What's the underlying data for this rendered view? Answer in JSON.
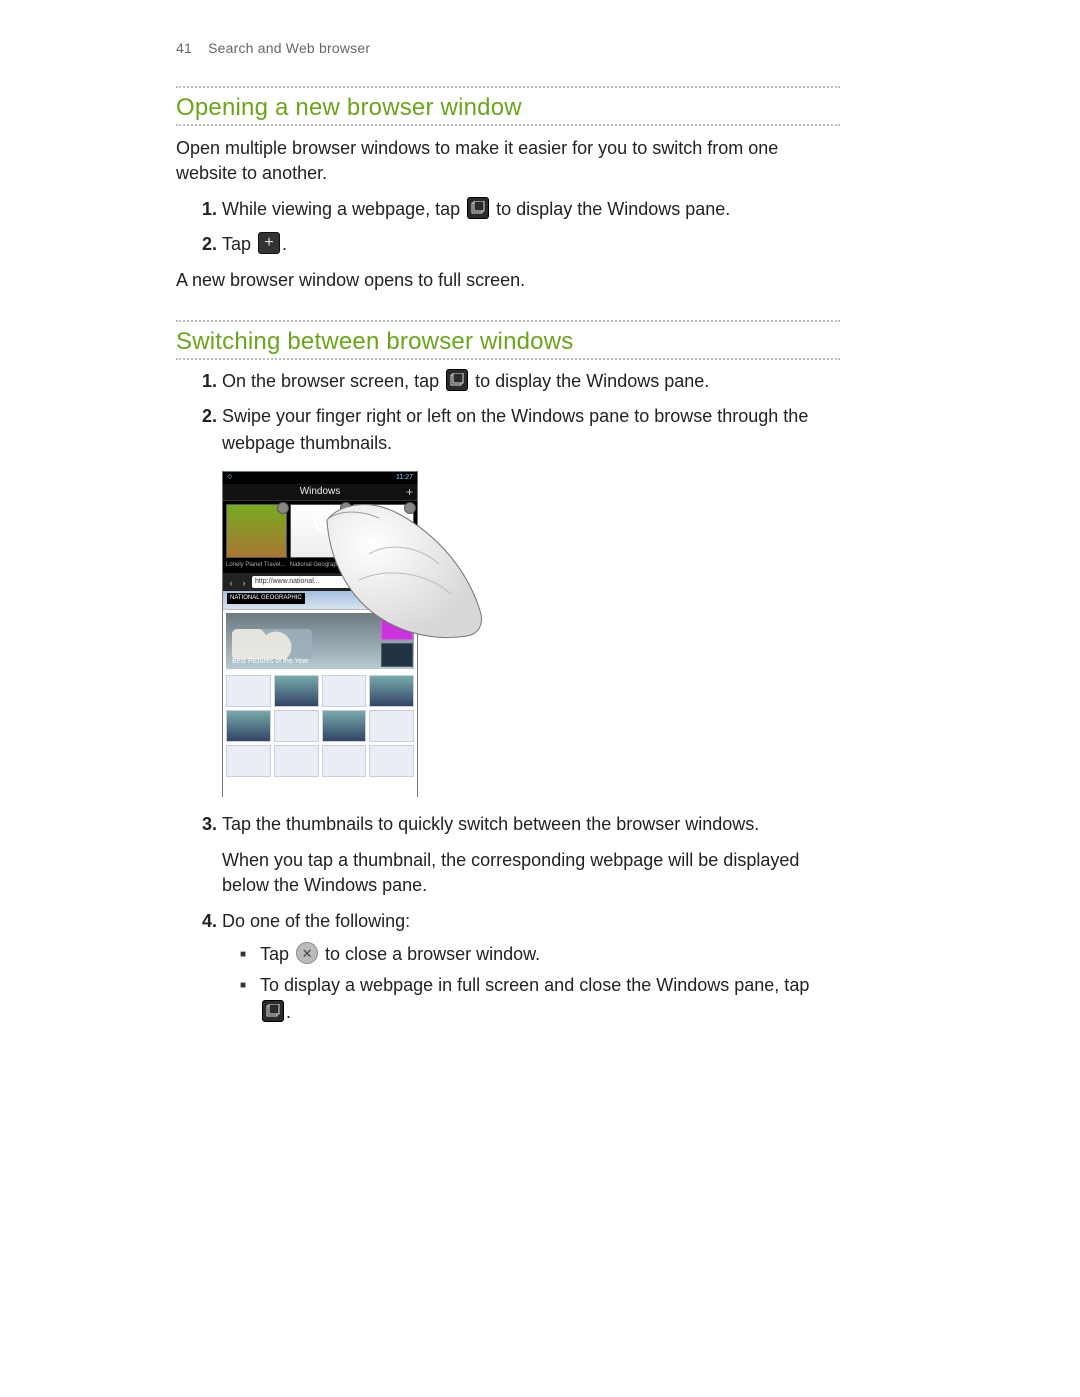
{
  "header": {
    "page_number": "41",
    "breadcrumb": "Search and Web browser"
  },
  "section1": {
    "title": "Opening a new browser window",
    "intro": "Open multiple browser windows to make it easier for you to switch from one website to another.",
    "step1_pre": "While viewing a webpage, tap ",
    "step1_post": " to display the Windows pane.",
    "step2_pre": "Tap ",
    "step2_post": ".",
    "outro": "A new browser window opens to full screen."
  },
  "section2": {
    "title": "Switching between browser windows",
    "step1_pre": "On the browser screen, tap ",
    "step1_post": " to display the Windows pane.",
    "step2": "Swipe your finger right or left on the Windows pane to browse through the webpage thumbnails.",
    "phone": {
      "status_time": "11:27",
      "windows_label": "Windows",
      "thumb_caption_left": "Lonely Planet Travel...",
      "thumb_caption_right": "National Geograp...",
      "url": "http://www.national...",
      "brand": "NATIONAL GEOGRAPHIC",
      "feature_caption": "Best Pictures of the Year"
    },
    "step3": "Tap the thumbnails to quickly switch between the browser windows.",
    "step3_note": "When you tap a thumbnail, the corresponding webpage will be displayed below the Windows pane.",
    "step4": "Do one of the following:",
    "step4_bullet1_pre": "Tap ",
    "step4_bullet1_post": " to close a browser window.",
    "step4_bullet2_pre": "To display a webpage in full screen and close the Windows pane, tap",
    "step4_bullet2_post": "."
  },
  "icons": {
    "windows_pane": "windows-pane-icon",
    "plus": "plus-icon",
    "close": "close-icon"
  }
}
